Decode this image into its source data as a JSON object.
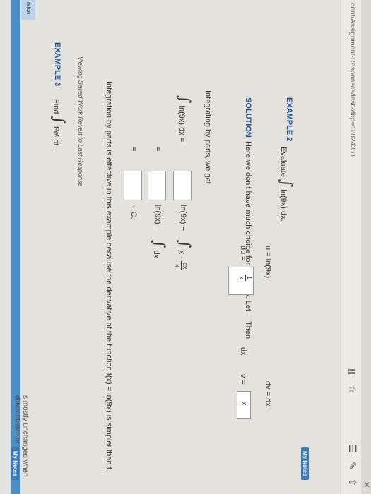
{
  "browser": {
    "url": "dent/Assignment-Responses/last?dep=18824331",
    "close_glyph": "×",
    "new_tab_glyph": "+",
    "chevron_glyph": "⌄",
    "reader_icon": "▥",
    "star_icon": "☆",
    "menu_icon": "☰",
    "pen_icon": "✎",
    "share_icon": "⇧"
  },
  "notes": {
    "top_label": "My Notes",
    "bottom_label": "My Notes"
  },
  "example2": {
    "label": "EXAMPLE 2",
    "evaluate": "Evaluate",
    "integral_symbol": "∫",
    "integrand": "ln(9x) dx.",
    "solution_label": "SOLUTION",
    "solution_text": "Here we don't have much choice for u and dv. Let",
    "u_def": "u = ln(9x)",
    "dv_def": "dv = dx.",
    "then": "Then",
    "du_label": "du =",
    "du_num": "1",
    "du_den": "x",
    "dx_after": "dx",
    "v_label": "v =",
    "v_value": "x",
    "integrating": "Integrating by parts, we get",
    "line1_left": "ln(9x) dx =",
    "line1_mid": "ln(9x) −",
    "line1_integral": "x ·",
    "line1_frac_num": "dx",
    "line1_frac_den": "x",
    "line2_eq": "=",
    "line2_mid": "ln(9x) −",
    "line2_integral": "dx",
    "line3_eq": "=",
    "line3_tail": "+ C.",
    "conclusion": "Integration by parts is effective in this example because the derivative of the function  f(x) = ln(9x)  is simpler than f."
  },
  "saved_work": {
    "left_tab": "rsion",
    "text": "Viewing Saved Work Revert to Last Response"
  },
  "example3": {
    "label": "EXAMPLE 3",
    "find": "Find",
    "integral_symbol": "∫",
    "integrand": "t²eᵗ dt.",
    "footer": "s mostly unchanged when differentiated or"
  }
}
